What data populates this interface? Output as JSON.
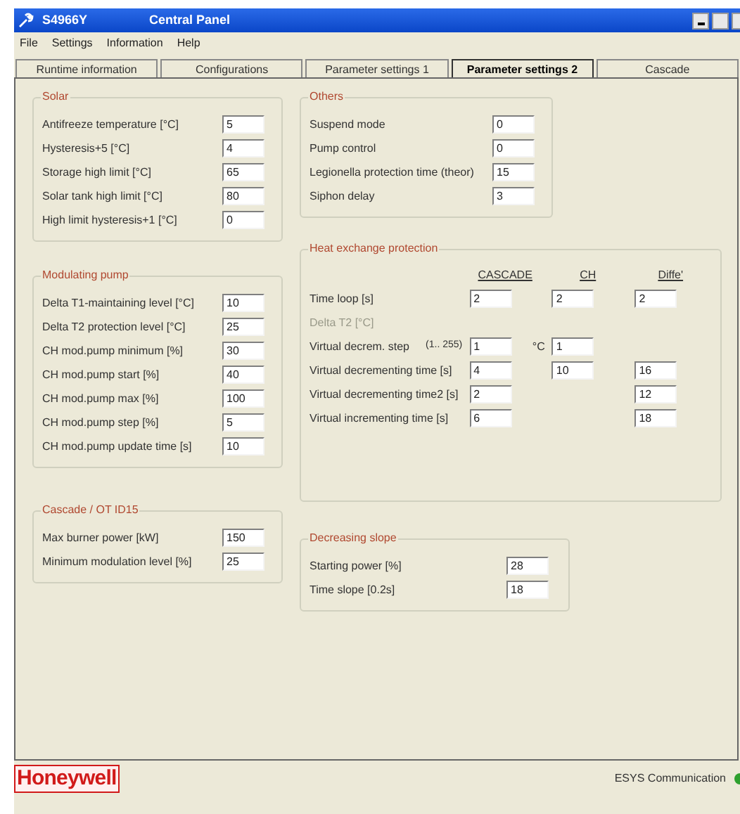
{
  "window": {
    "title": "S4966Y",
    "subtitle": "Central Panel"
  },
  "menu": [
    "File",
    "Settings",
    "Information",
    "Help"
  ],
  "tabs": [
    {
      "label": "Runtime information",
      "selected": false
    },
    {
      "label": "Configurations",
      "selected": false
    },
    {
      "label": "Parameter settings 1",
      "selected": false
    },
    {
      "label": "Parameter settings 2",
      "selected": true
    },
    {
      "label": "Cascade",
      "selected": false
    }
  ],
  "left_groups": [
    {
      "title": "Solar",
      "fields": [
        {
          "label": "Antifreeze temperature [°C]",
          "value": "5"
        },
        {
          "label": "Hysteresis+5 [°C]",
          "value": "4"
        },
        {
          "label": "Storage high limit [°C]",
          "value": "65"
        },
        {
          "label": "Solar tank high limit [°C]",
          "value": "80"
        },
        {
          "label": "High limit hysteresis+1 [°C]",
          "value": "0"
        }
      ]
    },
    {
      "title": "Modulating pump",
      "fields": [
        {
          "label": "Delta T1-maintaining level [°C]",
          "value": "10"
        },
        {
          "label": "Delta T2 protection level [°C]",
          "value": "25"
        },
        {
          "label": "CH mod.pump minimum [%]",
          "value": "30"
        },
        {
          "label": "CH mod.pump start [%]",
          "value": "40"
        },
        {
          "label": "CH mod.pump max [%]",
          "value": "100"
        },
        {
          "label": "CH mod.pump step [%]",
          "value": "5"
        },
        {
          "label": "CH mod.pump update time [s]",
          "value": "10"
        }
      ]
    },
    {
      "title": "Cascade / OT ID15",
      "fields": [
        {
          "label": "Max burner power [kW]",
          "value": "150"
        },
        {
          "label": "Minimum modulation level [%]",
          "value": "25"
        }
      ]
    }
  ],
  "others": {
    "title": "Others",
    "fields": [
      {
        "label": "Suspend mode",
        "value": "0"
      },
      {
        "label": "Pump control",
        "value": "0"
      },
      {
        "label": "Legionella protection time (theor)",
        "value": "15"
      },
      {
        "label": "Siphon delay",
        "value": "3"
      }
    ]
  },
  "heat_exchange": {
    "title": "Heat exchange protection",
    "columns": [
      "CASCADE",
      "CH",
      "Diffe'"
    ],
    "rows": [
      {
        "label": "Time loop [s]",
        "disabled": false,
        "cells": [
          "2",
          "2",
          "2"
        ]
      },
      {
        "label": "Delta T2 [°C]",
        "disabled": true,
        "cells": [
          null,
          null,
          null
        ]
      },
      {
        "label": "Virtual decrem. step",
        "disabled": false,
        "range": "(1.. 255)",
        "unit": "°C",
        "cells": [
          "1",
          "1",
          null
        ]
      },
      {
        "label": "Virtual decrementing time [s]",
        "disabled": false,
        "cells": [
          "4",
          "10",
          "16"
        ]
      },
      {
        "label": "Virtual decrementing time2 [s]",
        "disabled": false,
        "cells": [
          "2",
          null,
          "12"
        ]
      },
      {
        "label": "Virtual incrementing time [s]",
        "disabled": false,
        "cells": [
          "6",
          null,
          "18"
        ]
      }
    ]
  },
  "decreasing_slope": {
    "title": "Decreasing slope",
    "fields": [
      {
        "label": "Starting power [%]",
        "value": "28"
      },
      {
        "label": "Time slope [0.2s]",
        "value": "18"
      }
    ]
  },
  "footer": {
    "logo": "Honeywell",
    "status": "ESYS Communication",
    "connected": true
  }
}
